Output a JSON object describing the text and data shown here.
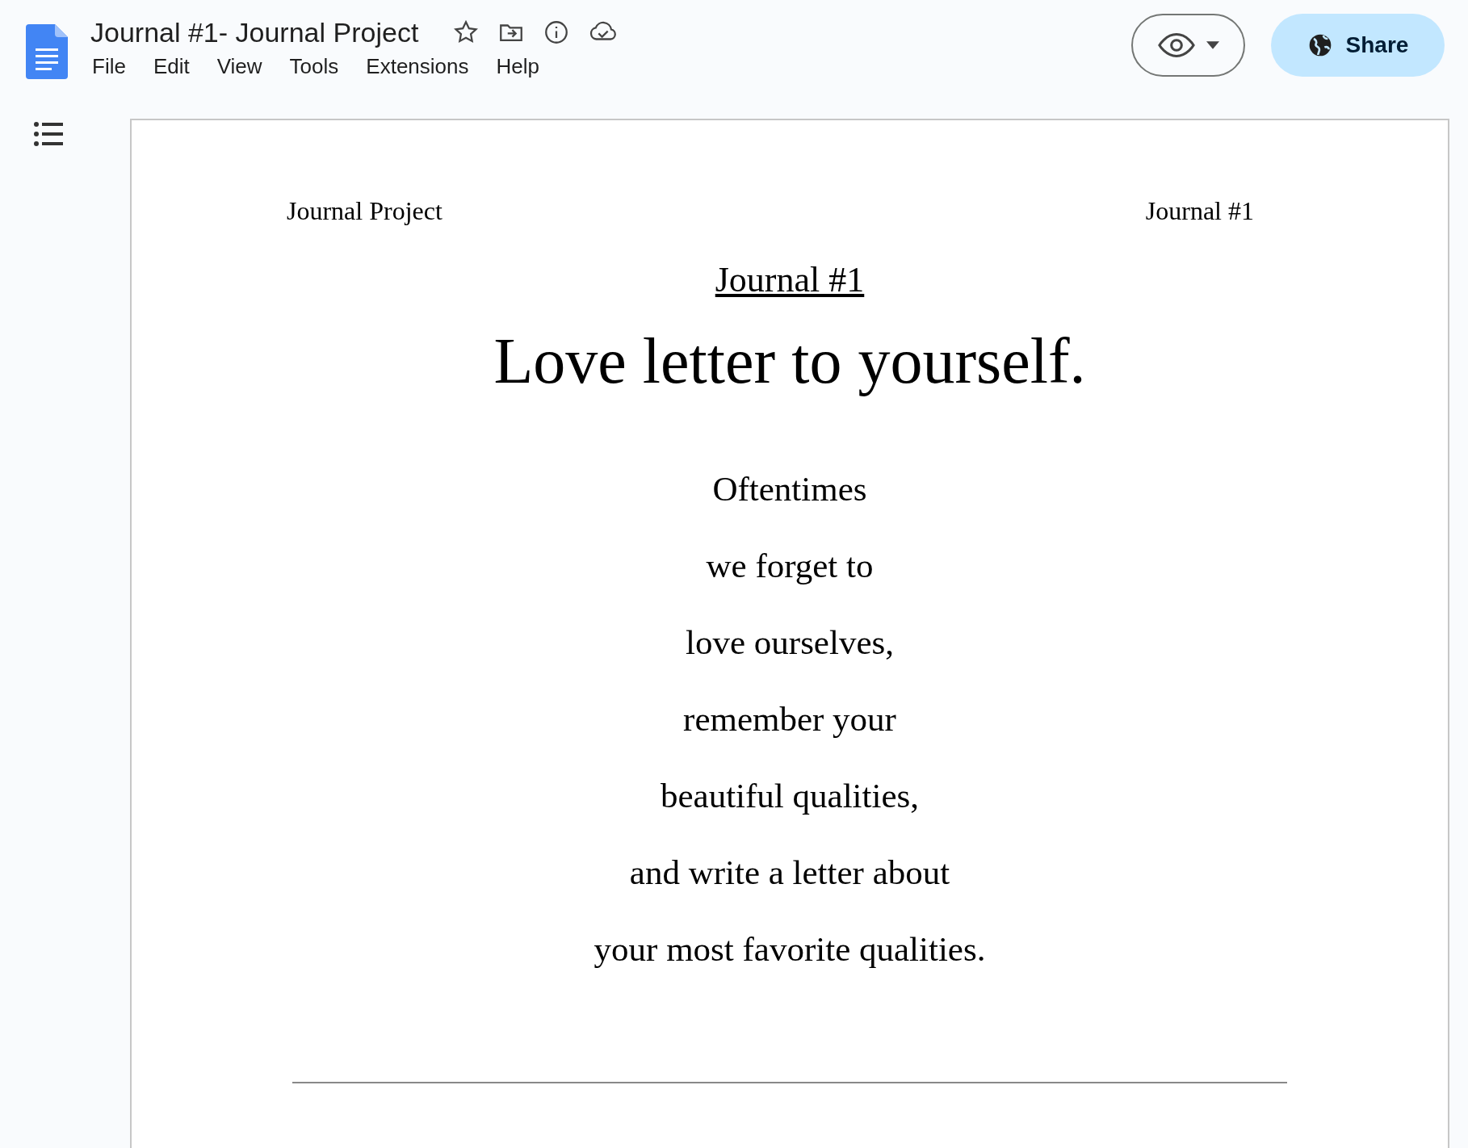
{
  "title_bar": {
    "title": "Journal #1- Journal Project",
    "starred": false
  },
  "menu": [
    "File",
    "Edit",
    "View",
    "Tools",
    "Extensions",
    "Help"
  ],
  "share_button": {
    "label": "Share"
  },
  "document": {
    "header_left": "Journal Project",
    "header_right": "Journal #1",
    "subtitle": "Journal #1",
    "heading": "Love letter to yourself.",
    "lines": [
      "Oftentimes",
      "we forget to",
      "love ourselves,",
      "remember your",
      "beautiful qualities,",
      "and write a letter about",
      "your most favorite qualities."
    ]
  }
}
